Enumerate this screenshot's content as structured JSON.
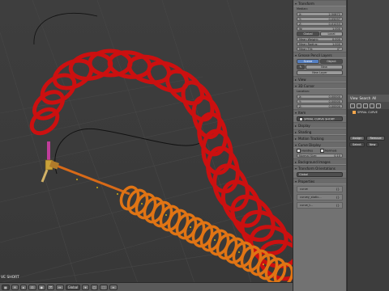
{
  "viewport": {
    "view_label": "VE SHORT",
    "header": {
      "mode": "Global",
      "buttons": [
        "+",
        "▸",
        "⊡",
        "◉",
        "⤧",
        "↔",
        "⌖",
        "▢",
        "⬚",
        "≡"
      ]
    }
  },
  "properties": {
    "transform_header": "Transform",
    "median_label": "Median:",
    "x_label": "X:",
    "x_value": "2.50872",
    "y_label": "Y:",
    "y_value": "0.05097",
    "z_label": "Z:",
    "z_value": "0.01253",
    "w_label": "W:",
    "w_value": "1.000",
    "global_label": "Global",
    "local_label": "Local",
    "mean_weight_label": "Mean Weight:",
    "mean_weight_value": "0.000",
    "mean_radius_label": "Mean Radius:",
    "mean_radius_value": "1.000",
    "mean_tilt_label": "Mean Tilt:",
    "mean_tilt_value": "0°",
    "grease_header": "Grease Pencil Layers",
    "scene_label": "Scene",
    "object_label": "Object",
    "new_label": "New",
    "new_layer_label": "New Layer",
    "view_header": "View",
    "cursor_header": "3D Cursor",
    "location_label": "Location:",
    "cx_label": "X:",
    "cx_value": "0.00000",
    "cy_label": "Y:",
    "cy_value": "0.00000",
    "cz_label": "Z:",
    "cz_value": "0.00000",
    "item_header": "Item",
    "item_name": "SPIRAL CURVE SHORT",
    "display_header": "Display",
    "shading_header": "Shading",
    "motion_header": "Motion Tracking",
    "curve_display_header": "Curve Display",
    "handles_label": "Handles",
    "normals_label": "Normals",
    "normal_size_label": "Normal Size:",
    "normal_size_value": "0.10",
    "bg_header": "Background Images",
    "orient_header": "Transform Orientations",
    "orient_value": "Global",
    "properties_header": "Properties",
    "custom_props": [
      {
        "label": "curve",
        "value": "{}"
      },
      {
        "label": "curvey_static...",
        "value": "{}"
      },
      {
        "label": "curve_t...",
        "value": "{}"
      }
    ]
  },
  "outliner": {
    "view_label": "View",
    "search_label": "Search",
    "all_scenes_label": "All",
    "item_label": "SPIRAL CURVE",
    "assign_label": "Assign",
    "remove_label": "Remove",
    "select_label": "Select",
    "new_label": "New"
  }
}
